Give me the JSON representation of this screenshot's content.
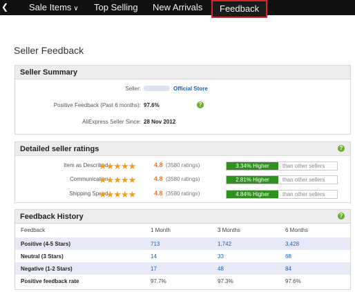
{
  "nav": {
    "items": [
      {
        "label": "Sale Items",
        "has_dropdown": true
      },
      {
        "label": "Top Selling"
      },
      {
        "label": "New Arrivals"
      },
      {
        "label": "Feedback",
        "active": true
      }
    ]
  },
  "page": {
    "title": "Seller Feedback"
  },
  "summary": {
    "heading": "Seller Summary",
    "seller_label": "Seller:",
    "store_name": "Official Store",
    "positive_label": "Positive Feedback (Past 6 months):",
    "positive_value": "97.6%",
    "since_label": "AliExpress Seller Since:",
    "since_value": "28 Nov 2012"
  },
  "ratings": {
    "heading": "Detailed seller ratings",
    "items": [
      {
        "label": "Item as Described :",
        "stars": "★★★★★",
        "score": "4.8",
        "count": "(3580 ratings)",
        "higher": "3.34% Higher",
        "compare": "than other sellers"
      },
      {
        "label": "Communication :",
        "stars": "★★★★★",
        "score": "4.8",
        "count": "(3580 ratings)",
        "higher": "2.81% Higher",
        "compare": "than other sellers"
      },
      {
        "label": "Shipping Speed :",
        "stars": "★★★★★",
        "score": "4.8",
        "count": "(3580 ratings)",
        "higher": "4.84% Higher",
        "compare": "than other sellers"
      }
    ]
  },
  "history": {
    "heading": "Feedback History",
    "columns": [
      "Feedback",
      "1 Month",
      "3 Months",
      "6 Months"
    ],
    "rows": [
      {
        "label": "Positive (4-5 Stars)",
        "m1": "713",
        "m3": "1,742",
        "m6": "3,428"
      },
      {
        "label": "Neutral (3 Stars)",
        "m1": "14",
        "m3": "33",
        "m6": "68"
      },
      {
        "label": "Negative (1-2 Stars)",
        "m1": "17",
        "m3": "48",
        "m6": "84"
      },
      {
        "label": "Positive feedback rate",
        "m1": "97.7%",
        "m3": "97.3%",
        "m6": "97.6%"
      }
    ]
  },
  "colors": {
    "nav_bg": "#111111",
    "active_border": "#d9262b",
    "link": "#1a5fb4",
    "score": "#e8702a",
    "star": "#f39a21",
    "higher_green": "#2f8f1f",
    "help_green": "#6fae2c",
    "alt_row": "#e8e9f6"
  },
  "icons": {
    "help": "help-circle-icon",
    "star": "star-icon",
    "chevron": "chevron-down-icon"
  }
}
